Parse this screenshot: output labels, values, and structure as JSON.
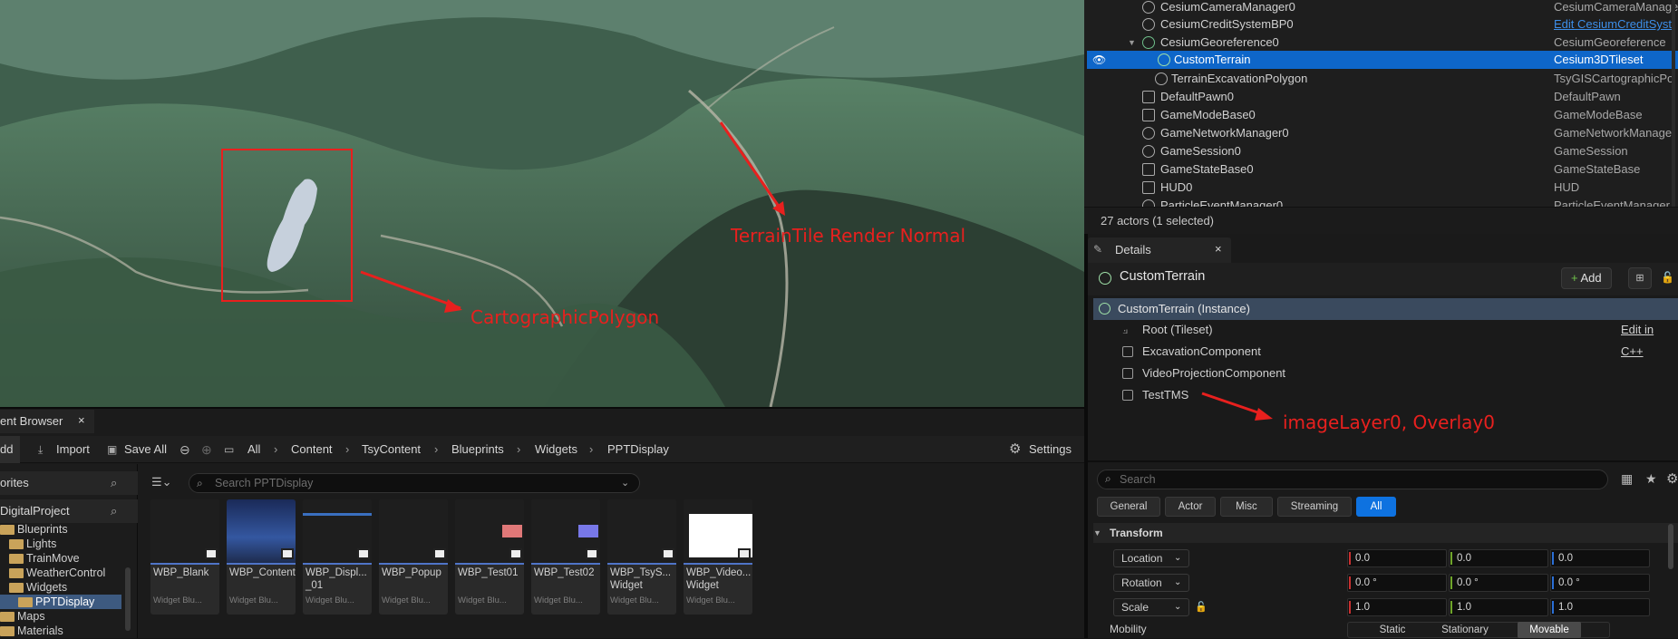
{
  "viewport": {
    "annotations": {
      "terrain_tile": "TerrainTile Render Normal",
      "cartographic": "CartographicPolygon",
      "image_layer": "imageLayer0, Overlay0"
    },
    "annotation_color": "#e8201e"
  },
  "outliner": {
    "rows": [
      {
        "name": "CesiumCameraManager0",
        "type": "CesiumCameraManage"
      },
      {
        "name": "CesiumCreditSystemBP0",
        "type": "Edit CesiumCreditSyst"
      },
      {
        "name": "CesiumGeoreference0",
        "type": "CesiumGeoreference"
      },
      {
        "name": "CustomTerrain",
        "type": "Cesium3DTileset"
      },
      {
        "name": "TerrainExcavationPolygon",
        "type": "TsyGISCartographicPo"
      },
      {
        "name": "DefaultPawn0",
        "type": "DefaultPawn"
      },
      {
        "name": "GameModeBase0",
        "type": "GameModeBase"
      },
      {
        "name": "GameNetworkManager0",
        "type": "GameNetworkManage"
      },
      {
        "name": "GameSession0",
        "type": "GameSession"
      },
      {
        "name": "GameStateBase0",
        "type": "GameStateBase"
      },
      {
        "name": "HUD0",
        "type": "HUD"
      },
      {
        "name": "ParticleEventManager0",
        "type": "ParticleEventManager"
      }
    ],
    "actor_count": "27 actors (1 selected)"
  },
  "details": {
    "tab": "Details",
    "close": "×",
    "title": "CustomTerrain",
    "add_label": "Add",
    "instance_label": "CustomTerrain (Instance)",
    "components": [
      {
        "name": "Root (Tileset)"
      },
      {
        "name": "ExcavationComponent"
      },
      {
        "name": "VideoProjectionComponent"
      },
      {
        "name": "TestTMS"
      }
    ],
    "edit_cpp": "Edit in C++",
    "search_placeholder": "Search",
    "filters": [
      "General",
      "Actor",
      "Misc",
      "Streaming",
      "All"
    ],
    "section": "Transform",
    "props": [
      {
        "label": "Location",
        "x": "0.0",
        "y": "0.0",
        "z": "0.0"
      },
      {
        "label": "Rotation",
        "x": "0.0 °",
        "y": "0.0 °",
        "z": "0.0 °"
      },
      {
        "label": "Scale",
        "x": "1.0",
        "y": "1.0",
        "z": "1.0"
      }
    ],
    "mobility_label": "Mobility",
    "mobility_options": [
      "Static",
      "Stationary",
      "Movable"
    ]
  },
  "content_browser": {
    "tab": "ent Browser",
    "close": "×",
    "toolbar": {
      "add": "dd",
      "import": "Import",
      "save_all": "Save All",
      "settings": "Settings"
    },
    "breadcrumb": [
      "All",
      "Content",
      "TsyContent",
      "Blueprints",
      "Widgets",
      "PPTDisplay"
    ],
    "sidebar": {
      "favorites": "orites",
      "project": "DigitalProject",
      "tree": [
        "Blueprints",
        "Lights",
        "TrainMove",
        "WeatherControl",
        "Widgets",
        "PPTDisplay",
        "Maps",
        "Materials"
      ]
    },
    "search_placeholder": "Search PPTDisplay",
    "assets": [
      {
        "name": "WBP_Blank",
        "type": "Widget Blu..."
      },
      {
        "name": "WBP_Content",
        "type": "Widget Blu..."
      },
      {
        "name": "WBP_Displ... _01",
        "type": "Widget Blu..."
      },
      {
        "name": "WBP_Popup",
        "type": "Widget Blu..."
      },
      {
        "name": "WBP_Test01",
        "type": "Widget Blu..."
      },
      {
        "name": "WBP_Test02",
        "type": "Widget Blu..."
      },
      {
        "name": "WBP_TsyS... Widget",
        "type": "Widget Blu..."
      },
      {
        "name": "WBP_Video... Widget",
        "type": "Widget Blu..."
      }
    ]
  }
}
